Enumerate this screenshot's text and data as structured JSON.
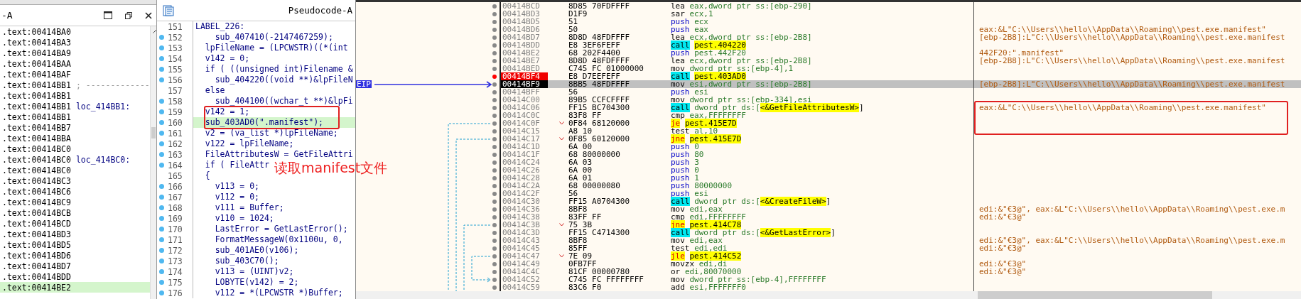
{
  "ida_view": {
    "title": "-A",
    "rows": [
      {
        "address": ".text:00414BA0",
        "selected": false
      },
      {
        "address": ".text:00414BA3",
        "selected": false
      },
      {
        "address": ".text:00414BA9",
        "selected": false
      },
      {
        "address": ".text:00414BAA",
        "selected": false
      },
      {
        "address": ".text:00414BAF",
        "selected": false
      },
      {
        "address": ".text:00414BB1",
        "note": "; -------------",
        "kind": "separator",
        "selected": false
      },
      {
        "address": ".text:00414BB1",
        "selected": false
      },
      {
        "address": ".text:00414BB1",
        "note": "loc_414BB1:",
        "kind": "label",
        "selected": false
      },
      {
        "address": ".text:00414BB1",
        "selected": false
      },
      {
        "address": ".text:00414BB7",
        "selected": false
      },
      {
        "address": ".text:00414BBA",
        "selected": false
      },
      {
        "address": ".text:00414BC0",
        "selected": false
      },
      {
        "address": ".text:00414BC0",
        "note": "loc_414BC0:",
        "kind": "label",
        "selected": false
      },
      {
        "address": ".text:00414BC0",
        "selected": false
      },
      {
        "address": ".text:00414BC3",
        "selected": false
      },
      {
        "address": ".text:00414BC6",
        "selected": false
      },
      {
        "address": ".text:00414BC9",
        "selected": false
      },
      {
        "address": ".text:00414BCB",
        "selected": false
      },
      {
        "address": ".text:00414BCD",
        "selected": false
      },
      {
        "address": ".text:00414BD3",
        "selected": false
      },
      {
        "address": ".text:00414BD5",
        "selected": false
      },
      {
        "address": ".text:00414BD6",
        "selected": false
      },
      {
        "address": ".text:00414BD7",
        "selected": false
      },
      {
        "address": ".text:00414BDD",
        "selected": false
      },
      {
        "address": ".text:00414BE2",
        "selected": true
      }
    ]
  },
  "pseudocode": {
    "title": "Pseudocode-A",
    "lines": [
      {
        "number": "151",
        "code": "LABEL_226:",
        "dot": false,
        "selected": false
      },
      {
        "number": "152",
        "code": "    sub_407410(-2147467259);",
        "dot": true,
        "selected": false
      },
      {
        "number": "153",
        "code": "  lpFileName = (LPCWSTR)((*(int",
        "dot": true,
        "selected": false
      },
      {
        "number": "154",
        "code": "  v142 = 0;",
        "dot": true,
        "selected": false
      },
      {
        "number": "155",
        "code": "  if ( ((unsigned int)Filename &",
        "dot": true,
        "selected": false
      },
      {
        "number": "156",
        "code": "    sub_404220((void **)&lpFileN",
        "dot": true,
        "selected": false
      },
      {
        "number": "157",
        "code": "  else",
        "dot": false,
        "selected": false
      },
      {
        "number": "158",
        "code": "    sub_404100((wchar_t **)&lpFi",
        "dot": true,
        "selected": false
      },
      {
        "number": "159",
        "code": "  v142 = 1;",
        "dot": true,
        "selected": false
      },
      {
        "number": "160",
        "code": "  sub_403AD0(\".manifest\");",
        "dot": true,
        "selected": true
      },
      {
        "number": "161",
        "code": "  v2 = (va_list *)lpFileName;",
        "dot": true,
        "selected": false
      },
      {
        "number": "162",
        "code": "  v122 = lpFileName;",
        "dot": true,
        "selected": false
      },
      {
        "number": "163",
        "code": "  FileAttributesW = GetFileAttri",
        "dot": true,
        "selected": false
      },
      {
        "number": "164",
        "code": "  if ( FileAttr",
        "dot": true,
        "selected": false
      },
      {
        "number": "165",
        "code": "  {",
        "dot": false,
        "selected": false
      },
      {
        "number": "166",
        "code": "    v113 = 0;",
        "dot": true,
        "selected": false
      },
      {
        "number": "167",
        "code": "    v112 = 0;",
        "dot": true,
        "selected": false
      },
      {
        "number": "168",
        "code": "    v111 = Buffer;",
        "dot": true,
        "selected": false
      },
      {
        "number": "169",
        "code": "    v110 = 1024;",
        "dot": true,
        "selected": false
      },
      {
        "number": "170",
        "code": "    LastError = GetLastError();",
        "dot": true,
        "selected": false
      },
      {
        "number": "171",
        "code": "    FormatMessageW(0x1100u, 0,",
        "dot": true,
        "selected": false
      },
      {
        "number": "172",
        "code": "    sub_401AE0(v106);",
        "dot": true,
        "selected": false
      },
      {
        "number": "173",
        "code": "    sub_403C70();",
        "dot": true,
        "selected": false
      },
      {
        "number": "174",
        "code": "    v113 = (UINT)v2;",
        "dot": true,
        "selected": false
      },
      {
        "number": "175",
        "code": "    LOBYTE(v142) = 2;",
        "dot": true,
        "selected": false
      },
      {
        "number": "176",
        "code": "    v112 = *(LPCWSTR *)Buffer;",
        "dot": true,
        "selected": false
      }
    ]
  },
  "annotation": {
    "text": "读取manifest文件"
  },
  "debugger": {
    "eip_label": "EIP",
    "rows": [
      {
        "address": "00414BCD",
        "bytes": "8D85 70FDFFFF",
        "mnemonic": "lea",
        "operands": "eax,dword ptr ss:[ebp-290]",
        "kind": "plain",
        "breakpoint": false,
        "current": false
      },
      {
        "address": "00414BD3",
        "bytes": "D1F9",
        "mnemonic": "sar",
        "operands": "ecx,1",
        "kind": "plain",
        "breakpoint": false,
        "current": false
      },
      {
        "address": "00414BD5",
        "bytes": "51",
        "mnemonic": "push",
        "operands": "ecx",
        "kind": "push",
        "breakpoint": false,
        "current": false
      },
      {
        "address": "00414BD6",
        "bytes": "50",
        "mnemonic": "push",
        "operands": "eax",
        "kind": "push",
        "breakpoint": false,
        "current": false,
        "comment": "eax:&L\"C:\\\\Users\\\\hello\\\\AppData\\\\Roaming\\\\pest.exe.manifest\""
      },
      {
        "address": "00414BD7",
        "bytes": "8D8D 48FDFFFF",
        "mnemonic": "lea",
        "operands": "ecx,dword ptr ss:[ebp-2B8]",
        "kind": "plain",
        "breakpoint": false,
        "current": false,
        "comment": "[ebp-2B8]:L\"C:\\\\Users\\\\hello\\\\AppData\\\\Roaming\\\\pest.exe.manifest"
      },
      {
        "address": "00414BDD",
        "bytes": "E8 3EF6FEFF",
        "mnemonic": "call",
        "target": "pest.404220",
        "kind": "call",
        "breakpoint": false,
        "current": false
      },
      {
        "address": "00414BE2",
        "bytes": "68 202F4400",
        "mnemonic": "push",
        "operands": "pest.442F20",
        "kind": "push",
        "breakpoint": false,
        "current": false,
        "comment": "442F20:\".manifest\""
      },
      {
        "address": "00414BE7",
        "bytes": "8D8D 48FDFFFF",
        "mnemonic": "lea",
        "operands": "ecx,dword ptr ss:[ebp-2B8]",
        "kind": "plain",
        "breakpoint": false,
        "current": false,
        "comment": "[ebp-2B8]:L\"C:\\\\Users\\\\hello\\\\AppData\\\\Roaming\\\\pest.exe.manifest"
      },
      {
        "address": "00414BED",
        "bytes": "C745 FC 01000000",
        "mnemonic": "mov",
        "operands": "dword ptr ss:[ebp-4],1",
        "kind": "plain",
        "breakpoint": false,
        "current": false
      },
      {
        "address": "00414BF4",
        "bytes": "E8 D7EEFEFF",
        "mnemonic": "call",
        "target": "pest.403AD0",
        "kind": "call",
        "breakpoint": true,
        "current": false
      },
      {
        "address": "00414BF9",
        "bytes": "8BB5 48FDFFFF",
        "mnemonic": "mov",
        "operands": "esi,dword ptr ss:[ebp-2B8]",
        "kind": "plain",
        "breakpoint": false,
        "current": true,
        "comment": "[ebp-2B8]:L\"C:\\\\Users\\\\hello\\\\AppData\\\\Roaming\\\\pest.exe.manifest"
      },
      {
        "address": "00414BFF",
        "bytes": "56",
        "mnemonic": "push",
        "operands": "esi",
        "kind": "push",
        "breakpoint": false,
        "current": false
      },
      {
        "address": "00414C00",
        "bytes": "89B5 CCFCFFFF",
        "mnemonic": "mov",
        "operands": "dword ptr ss:[ebp-334],esi",
        "kind": "plain",
        "breakpoint": false,
        "current": false
      },
      {
        "address": "00414C06",
        "bytes": "FF15 BC704300",
        "mnemonic": "call",
        "operands": "dword ptr ds:[",
        "target": "<&GetFileAttributesW>",
        "after": "]",
        "kind": "call",
        "breakpoint": false,
        "current": false,
        "comment": "eax:&L\"C:\\\\Users\\\\hello\\\\AppData\\\\Roaming\\\\pest.exe.manifest\""
      },
      {
        "address": "00414C0C",
        "bytes": "83F8 FF",
        "mnemonic": "cmp",
        "operands": "eax,FFFFFFFF",
        "kind": "plain",
        "breakpoint": false,
        "current": false
      },
      {
        "address": "00414C0F",
        "bytes": "0F84 68120000",
        "mnemonic": "je",
        "target": "pest.415E7D",
        "kind": "jump",
        "breakpoint": false,
        "current": false
      },
      {
        "address": "00414C15",
        "bytes": "A8 10",
        "mnemonic": "test",
        "operands": "al,10",
        "kind": "plain",
        "breakpoint": false,
        "current": false
      },
      {
        "address": "00414C17",
        "bytes": "0F85 60120000",
        "mnemonic": "jne",
        "target": "pest.415E7D",
        "kind": "jump",
        "breakpoint": false,
        "current": false
      },
      {
        "address": "00414C1D",
        "bytes": "6A 00",
        "mnemonic": "push",
        "operands": "0",
        "kind": "push",
        "breakpoint": false,
        "current": false
      },
      {
        "address": "00414C1F",
        "bytes": "68 80000000",
        "mnemonic": "push",
        "operands": "80",
        "kind": "push",
        "breakpoint": false,
        "current": false
      },
      {
        "address": "00414C24",
        "bytes": "6A 03",
        "mnemonic": "push",
        "operands": "3",
        "kind": "push",
        "breakpoint": false,
        "current": false
      },
      {
        "address": "00414C26",
        "bytes": "6A 00",
        "mnemonic": "push",
        "operands": "0",
        "kind": "push",
        "breakpoint": false,
        "current": false
      },
      {
        "address": "00414C28",
        "bytes": "6A 01",
        "mnemonic": "push",
        "operands": "1",
        "kind": "push",
        "breakpoint": false,
        "current": false
      },
      {
        "address": "00414C2A",
        "bytes": "68 00000080",
        "mnemonic": "push",
        "operands": "80000000",
        "kind": "push",
        "breakpoint": false,
        "current": false
      },
      {
        "address": "00414C2F",
        "bytes": "56",
        "mnemonic": "push",
        "operands": "esi",
        "kind": "push",
        "breakpoint": false,
        "current": false
      },
      {
        "address": "00414C30",
        "bytes": "FF15 A0704300",
        "mnemonic": "call",
        "operands": "dword ptr ds:[",
        "target": "<&CreateFileW>",
        "after": "]",
        "kind": "call",
        "breakpoint": false,
        "current": false
      },
      {
        "address": "00414C36",
        "bytes": "8BF8",
        "mnemonic": "mov",
        "operands": "edi,eax",
        "kind": "plain",
        "breakpoint": false,
        "current": false,
        "comment": "edi:&\"€3@\", eax:&L\"C:\\\\Users\\\\hello\\\\AppData\\\\Roaming\\\\pest.exe.m"
      },
      {
        "address": "00414C38",
        "bytes": "83FF FF",
        "mnemonic": "cmp",
        "operands": "edi,FFFFFFFF",
        "kind": "plain",
        "breakpoint": false,
        "current": false,
        "comment": "edi:&\"€3@\""
      },
      {
        "address": "00414C3B",
        "bytes": "75 3B",
        "mnemonic": "jne",
        "target": "pest.414C78",
        "kind": "jump",
        "breakpoint": false,
        "current": false
      },
      {
        "address": "00414C3D",
        "bytes": "FF15 C4714300",
        "mnemonic": "call",
        "operands": "dword ptr ds:[",
        "target": "<&GetLastError>",
        "after": "]",
        "kind": "call",
        "breakpoint": false,
        "current": false
      },
      {
        "address": "00414C43",
        "bytes": "8BF8",
        "mnemonic": "mov",
        "operands": "edi,eax",
        "kind": "plain",
        "breakpoint": false,
        "current": false,
        "comment": "edi:&\"€3@\", eax:&L\"C:\\\\Users\\\\hello\\\\AppData\\\\Roaming\\\\pest.exe.m"
      },
      {
        "address": "00414C45",
        "bytes": "85FF",
        "mnemonic": "test",
        "operands": "edi,edi",
        "kind": "plain",
        "breakpoint": false,
        "current": false,
        "comment": "edi:&\"€3@\""
      },
      {
        "address": "00414C47",
        "bytes": "7E 09",
        "mnemonic": "jle",
        "target": "pest.414C52",
        "kind": "jump",
        "breakpoint": false,
        "current": false
      },
      {
        "address": "00414C49",
        "bytes": "0FB7FF",
        "mnemonic": "movzx",
        "operands": "edi,di",
        "kind": "plain",
        "breakpoint": false,
        "current": false,
        "comment": "edi:&\"€3@\""
      },
      {
        "address": "00414C4C",
        "bytes": "81CF 00000780",
        "mnemonic": "or",
        "operands": "edi,80070000",
        "kind": "plain",
        "breakpoint": false,
        "current": false,
        "comment": "edi:&\"€3@\""
      },
      {
        "address": "00414C52",
        "bytes": "C745 FC FFFFFFFF",
        "mnemonic": "mov",
        "operands": "dword ptr ss:[ebp-4],FFFFFFFF",
        "kind": "plain",
        "breakpoint": false,
        "current": false
      },
      {
        "address": "00414C59",
        "bytes": "83C6 F0",
        "mnemonic": "add",
        "operands": "esi,FFFFFFF0",
        "kind": "plain",
        "breakpoint": false,
        "current": false
      }
    ]
  }
}
